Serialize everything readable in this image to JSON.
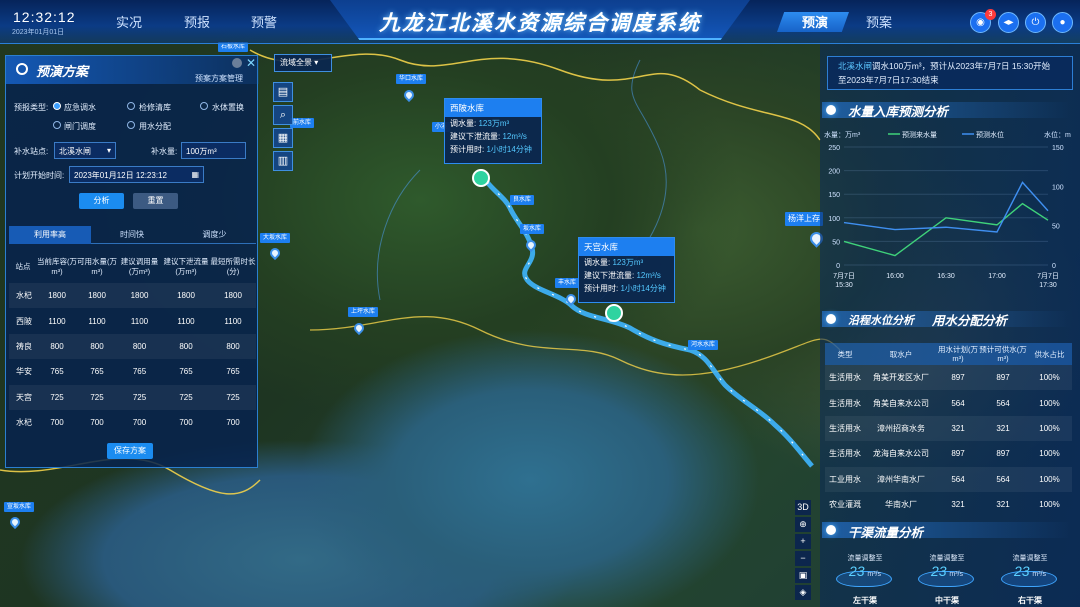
{
  "header": {
    "time": "12:32:12",
    "date": "2023年01月01日",
    "nav_left": [
      "实况",
      "预报",
      "预警"
    ],
    "title": "九龙江北溪水资源综合调度系统",
    "nav_right": [
      "预演",
      "预案"
    ],
    "notification_count": "3",
    "icons": [
      "bell-icon",
      "sync-icon",
      "power-icon",
      "user-icon"
    ]
  },
  "plan_panel": {
    "title": "预演方案",
    "manage_link": "预案方案管理",
    "type_label": "预报类型:",
    "type_options": [
      {
        "label": "应急调水",
        "selected": true
      },
      {
        "label": "检修清库",
        "selected": false
      },
      {
        "label": "水体置换",
        "selected": false
      },
      {
        "label": "闸门调度",
        "selected": false
      },
      {
        "label": "用水分配",
        "selected": false
      }
    ],
    "station_label": "补水站点:",
    "station_value": "北溪水闸",
    "amount_label": "补水量:",
    "amount_value": "100万m³",
    "start_label": "计划开始时间:",
    "start_value": "2023年01月12日 12:23:12",
    "analyze_button": "分析",
    "reset_button": "重置",
    "tabs": [
      "利用率高",
      "时间快",
      "调度少"
    ],
    "table_headers": [
      "站点",
      "当前库容(万m³)",
      "可用水量(万m³)",
      "建议调用量(万m³)",
      "建议下泄流量(万m³)",
      "最短所需时长(分)"
    ],
    "table_rows": [
      [
        "水杞",
        "1800",
        "1800",
        "1800",
        "1800",
        "1800"
      ],
      [
        "西陂",
        "1100",
        "1100",
        "1100",
        "1100",
        "1100"
      ],
      [
        "祷良",
        "800",
        "800",
        "800",
        "800",
        "800"
      ],
      [
        "华安",
        "765",
        "765",
        "765",
        "765",
        "765"
      ],
      [
        "天宫",
        "725",
        "725",
        "725",
        "725",
        "725"
      ],
      [
        "水杞",
        "700",
        "700",
        "700",
        "700",
        "700"
      ]
    ],
    "save_button": "保存方案"
  },
  "map": {
    "basin_select": "流域全景",
    "popups": [
      {
        "name": "西陂水库",
        "rows": [
          [
            "调水量:",
            "123万m³"
          ],
          [
            "建议下泄流量:",
            "12m³/s"
          ],
          [
            "预计用时:",
            "1小时14分钟"
          ]
        ]
      },
      {
        "name": "天宫水库",
        "rows": [
          [
            "调水量:",
            "123万m³"
          ],
          [
            "建议下泄流量:",
            "12m³/s"
          ],
          [
            "预计用时:",
            "1小时14分钟"
          ]
        ]
      }
    ],
    "labels": [
      "石板水库",
      "华口水库",
      "小溪",
      "良水库",
      "坂水库",
      "丰水库",
      "前水库",
      "大坂水库",
      "上坪水库",
      "河水水库",
      "宣坂水库",
      "杨洋上存"
    ],
    "right_tools": [
      "3D",
      "target-icon",
      "+",
      "−",
      "legend-icon",
      "layers-icon"
    ],
    "left_tools": [
      "layers-icon",
      "search-icon",
      "building-icon",
      "factory-icon"
    ]
  },
  "notice": {
    "prefix": "北溪水闸",
    "highlight": "调水100万m³",
    "text1": "，预计从2023年7月7日 15:30开始",
    "text2": "至2023年7月7日17:30结束"
  },
  "inflow_section": {
    "title": "水量入库预测分析"
  },
  "chart_data": {
    "type": "line",
    "ylabel_left": "水量：万m³",
    "ylabel_right": "水位：m",
    "legend": [
      "预测来水量",
      "预测水位"
    ],
    "x_labels": [
      "7月7日 15:30",
      "16:00",
      "16:30",
      "17:00",
      "7月7日 17:30"
    ],
    "ylim_left": [
      0,
      250
    ],
    "ylim_right": [
      0,
      150
    ],
    "yticks_left": [
      "0",
      "50",
      "100",
      "150",
      "200",
      "250"
    ],
    "yticks_right": [
      "0",
      "50",
      "100",
      "150"
    ],
    "series": [
      {
        "name": "预测来水量",
        "color": "#3fd27a",
        "x": [
          0,
          0.25,
          0.5,
          0.75,
          0.875,
          1
        ],
        "values": [
          50,
          20,
          100,
          85,
          130,
          95
        ]
      },
      {
        "name": "预测水位",
        "color": "#3f8ff0",
        "x": [
          0,
          0.25,
          0.5,
          0.75,
          0.875,
          1
        ],
        "values": [
          90,
          75,
          80,
          70,
          175,
          115
        ]
      }
    ]
  },
  "water_section": {
    "title_left": "沿程水位分析",
    "title_right": "用水分配分析"
  },
  "allocation_table": {
    "headers": [
      "类型",
      "取水户",
      "用水计划(万m³)",
      "预计可供水(万m³)",
      "供水占比"
    ],
    "rows": [
      [
        "生活用水",
        "角美开发区水厂",
        "897",
        "897",
        "100%"
      ],
      [
        "生活用水",
        "角美自来水公司",
        "564",
        "564",
        "100%"
      ],
      [
        "生活用水",
        "漳州招商水务",
        "321",
        "321",
        "100%"
      ],
      [
        "生活用水",
        "龙海自来水公司",
        "897",
        "897",
        "100%"
      ],
      [
        "工业用水",
        "漳州华南水厂",
        "564",
        "564",
        "100%"
      ],
      [
        "农业灌溉",
        "华南水厂",
        "321",
        "321",
        "100%"
      ]
    ]
  },
  "canal_section": {
    "title": "干渠流量分析",
    "items": [
      {
        "label": "流量调整至",
        "value": "23",
        "unit": "m³/s",
        "name": "左干渠"
      },
      {
        "label": "流量调整至",
        "value": "23",
        "unit": "m³/s",
        "name": "中干渠"
      },
      {
        "label": "流量调整至",
        "value": "23",
        "unit": "m³/s",
        "name": "右干渠"
      }
    ]
  }
}
